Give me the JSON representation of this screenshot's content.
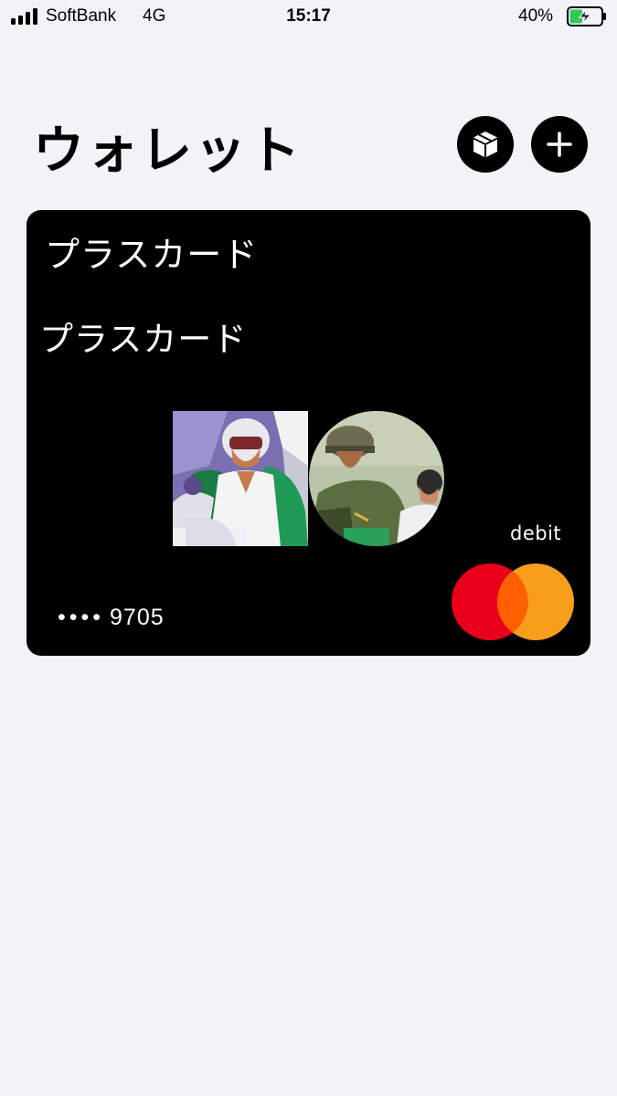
{
  "status_bar": {
    "carrier": "SoftBank",
    "network": "4G",
    "time": "15:17",
    "battery_percent": "40%",
    "battery_level": 0.4,
    "signal_bars": 4,
    "charging": true
  },
  "header": {
    "title": "ウォレット",
    "orders_icon": "package-box-icon",
    "add_icon": "plus-icon"
  },
  "card": {
    "name_top": "プラスカード",
    "name_art": "プラスカード",
    "type": "debit",
    "number_dots": "••••",
    "last4": "9705",
    "network_logo": "mastercard-logo",
    "colors": {
      "card_bg": "#000000",
      "mc_red": "#eb001b",
      "mc_orange": "#f79e1b",
      "mc_overlap": "#ff5f00"
    }
  },
  "colors": {
    "background": "#f2f2f7",
    "battery_charge": "#34c759"
  }
}
